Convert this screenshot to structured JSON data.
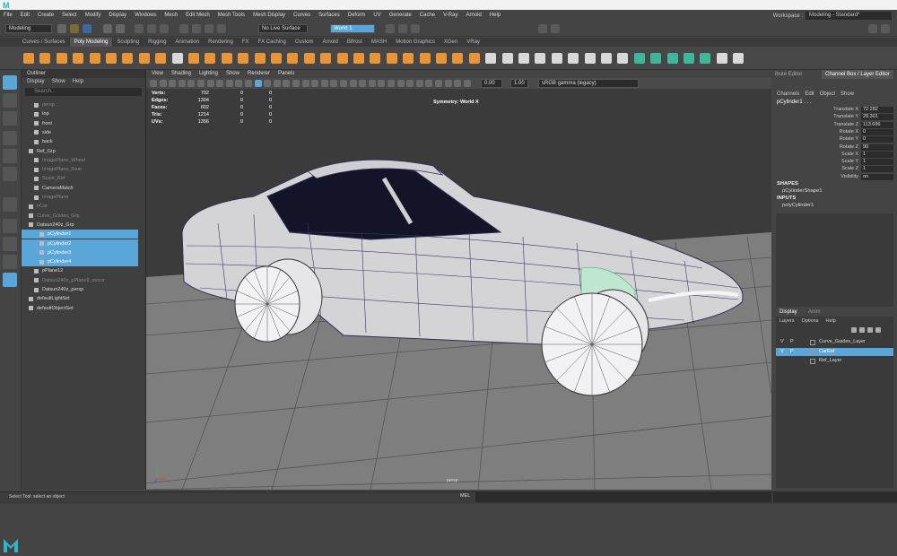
{
  "app": {
    "logo": "M"
  },
  "menu": [
    "File",
    "Edit",
    "Create",
    "Select",
    "Modify",
    "Display",
    "Windows",
    "Mesh",
    "Edit Mesh",
    "Mesh Tools",
    "Mesh Display",
    "Curves",
    "Surfaces",
    "Deform",
    "UV",
    "Generate",
    "Cache",
    "V-Ray",
    "Arnold",
    "Help"
  ],
  "workspace": {
    "label": "Workspace :",
    "value": "Modeling - Standard*"
  },
  "statusline": {
    "mode": "Modeling",
    "live_surface": "No Live Surface",
    "world": "World 1"
  },
  "shelf_tabs": [
    "Curves / Surfaces",
    "Poly Modeling",
    "Sculpting",
    "Rigging",
    "Animation",
    "Rendering",
    "FX",
    "FX Caching",
    "Custom",
    "Arnold",
    "Bifrost",
    "MASH",
    "Motion Graphics",
    "XGen",
    "VRay"
  ],
  "shelf_active": "Poly Modeling",
  "outliner": {
    "title": "Outliner",
    "menu": [
      "Display",
      "Show",
      "Help"
    ],
    "search_placeholder": "Search...",
    "items": [
      {
        "label": "persp",
        "dim": true
      },
      {
        "label": "top",
        "dim": false
      },
      {
        "label": "front",
        "dim": false
      },
      {
        "label": "side",
        "dim": false
      },
      {
        "label": "back",
        "dim": false
      },
      {
        "label": "Ref_Grp",
        "dim": false
      },
      {
        "label": "ImagePlane_Wheel",
        "dim": true
      },
      {
        "label": "ImagePlane_Rear",
        "dim": true
      },
      {
        "label": "Scale_Ref",
        "dim": true
      },
      {
        "label": "CameraMatch",
        "dim": false
      },
      {
        "label": "ImagePlane",
        "dim": true
      },
      {
        "label": "nCar",
        "dim": true
      },
      {
        "label": "Curve_Guides_Grp",
        "dim": true
      },
      {
        "label": "Datsun240z_Grp",
        "dim": false
      },
      {
        "label": "pCylinder1",
        "dim": false
      },
      {
        "label": "pCylinder2",
        "dim": false
      },
      {
        "label": "pCylinder3",
        "dim": false
      },
      {
        "label": "pCylinder4",
        "dim": false
      },
      {
        "label": "pPlane12",
        "dim": false
      },
      {
        "label": "Datsun240z_pPlane9_mirror",
        "dim": true
      },
      {
        "label": "Datsun240z_persp",
        "dim": false
      },
      {
        "label": "defaultLightSet",
        "dim": false
      },
      {
        "label": "defaultObjectSet",
        "dim": false
      }
    ]
  },
  "viewport": {
    "menu": [
      "View",
      "Shading",
      "Lighting",
      "Show",
      "Renderer",
      "Panels"
    ],
    "exposure": "0.00",
    "gamma": "1.00",
    "colorspace": "sRGB gamma (legacy)",
    "hud": [
      {
        "label": "Verts:",
        "v1": "702",
        "v2": "0",
        "v3": "0"
      },
      {
        "label": "Edges:",
        "v1": "1304",
        "v2": "0",
        "v3": "0"
      },
      {
        "label": "Faces:",
        "v1": "602",
        "v2": "0",
        "v3": "0"
      },
      {
        "label": "Tris:",
        "v1": "1214",
        "v2": "0",
        "v3": "0"
      },
      {
        "label": "UVs:",
        "v1": "1356",
        "v2": "0",
        "v3": "0"
      }
    ],
    "symmetry": "Symmetry: World X",
    "camera": "persp"
  },
  "channel_box": {
    "tabs": [
      "Modeling Toolkit",
      "Attribute Editor",
      "Channel Box / Layer Editor"
    ],
    "visible_tabs": [
      "ibute Editor",
      "Channel Box / Layer Editor"
    ],
    "menu": [
      "Channels",
      "Edit",
      "Object",
      "Show"
    ],
    "object": "pCylinder1 . . .",
    "attributes": [
      {
        "name": "Translate X",
        "value": "72.282"
      },
      {
        "name": "Translate Y",
        "value": "28.301"
      },
      {
        "name": "Translate Z",
        "value": "113.696"
      },
      {
        "name": "Rotate X",
        "value": "0"
      },
      {
        "name": "Rotate Y",
        "value": "0"
      },
      {
        "name": "Rotate Z",
        "value": "90"
      },
      {
        "name": "Scale X",
        "value": "1"
      },
      {
        "name": "Scale Y",
        "value": "1"
      },
      {
        "name": "Scale Z",
        "value": "1"
      },
      {
        "name": "Visibility",
        "value": "on"
      }
    ],
    "shapes_label": "SHAPES",
    "shape": "pCylinderShape1",
    "inputs_label": "INPUTS",
    "input": "polyCylinder1"
  },
  "layers": {
    "tabs": [
      "Display",
      "Anim"
    ],
    "menu": [
      "Layers",
      "Options",
      "Help"
    ],
    "rows": [
      {
        "v": "V",
        "p": "P",
        "name": "Curve_Guides_Layer",
        "selected": false
      },
      {
        "v": "V",
        "p": "P",
        "name": "CarRef",
        "selected": true
      },
      {
        "v": "",
        "p": "",
        "name": "Ref_Layer",
        "selected": false
      }
    ]
  },
  "footer": {
    "help": "Select Tool: select an object",
    "mel": "MEL"
  },
  "colors": {
    "accent": "#5aa6d8",
    "bg": "#444444",
    "grid": "#8a8a8a",
    "mesh": "#d6d6d8",
    "wire": "#3a3a60"
  }
}
